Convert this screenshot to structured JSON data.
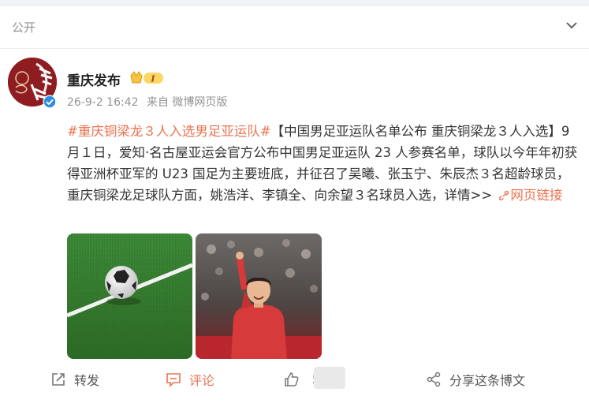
{
  "visibility": {
    "label": "公开"
  },
  "author": {
    "name": "重庆发布",
    "avatar_text": "重庆发布",
    "badge_level": "I",
    "time": "26-9-2 16:42",
    "source": "来自 微博网页版"
  },
  "post": {
    "hashtag": "#重庆铜梁龙３人入选男足亚运队#",
    "body": "【中国男足亚运队名单公布 重庆铜梁龙３人入选】9月１日，爱知·名古屋亚运会官方公布中国男足亚运队 23 人参赛名单，球队以今年年初获得亚洲杯亚军的 U23 国足为主要班底，并征召了吴曦、张玉宁、朱辰杰３名超龄球员，重庆铜梁龙足球队方面，姚浩洋、李镇全、向余望３名球员入选，详情>> ",
    "link_label": "网页链接"
  },
  "images": [
    {
      "name": "soccer-ball-on-grass"
    },
    {
      "name": "player-celebrating"
    }
  ],
  "actions": {
    "repost_label": "转发",
    "comment_label": "评论",
    "like_count": "5",
    "share_label": "分享这条博文"
  },
  "colors": {
    "accent": "#eb7350",
    "muted": "#939393",
    "verified": "#2d8fe0"
  }
}
